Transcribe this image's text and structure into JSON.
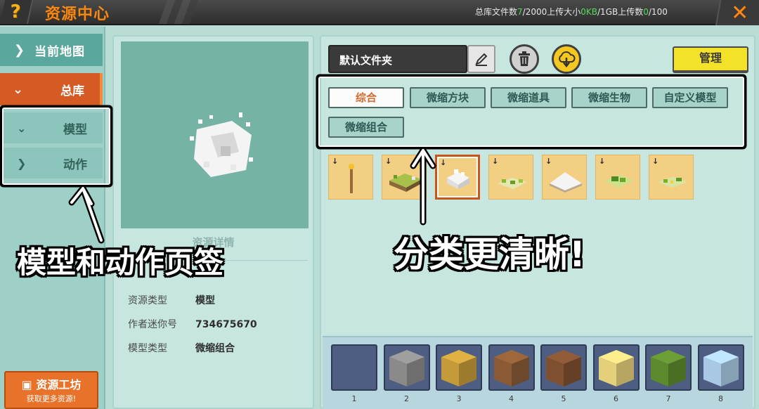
{
  "header": {
    "title": "资源中心",
    "help_icon": "?",
    "close_icon": "✕",
    "stats": {
      "files_label": "总库文件数",
      "files_used": "7",
      "files_total": "/2000",
      "size_label": "上传大小",
      "size_used": "0KB",
      "size_total": "/1GB",
      "uploads_label": "上传数",
      "uploads_used": "0",
      "uploads_total": "/100"
    }
  },
  "sidebar": {
    "current_map": "当前地图",
    "library": "总库",
    "model": "模型",
    "action": "动作",
    "workshop_title": "资源工坊",
    "workshop_sub": "获取更多资源!"
  },
  "detail": {
    "heading": "资源详情",
    "rows": [
      {
        "key": "资源类型",
        "value": "模型"
      },
      {
        "key": "作者迷你号",
        "value": "734675670"
      },
      {
        "key": "模型类型",
        "value": "微缩组合"
      }
    ]
  },
  "main": {
    "folder_name": "默认文件夹",
    "manage_label": "管理",
    "tabs": [
      "综合",
      "微缩方块",
      "微缩道具",
      "微缩生物",
      "自定义模型",
      "微缩组合"
    ],
    "active_tab": 0,
    "download_icon": "↓",
    "items": [
      {
        "icon": "torch-icon"
      },
      {
        "icon": "grass-block-icon"
      },
      {
        "icon": "white-cubes-icon",
        "selected": true
      },
      {
        "icon": "green-patch-icon"
      },
      {
        "icon": "snow-mound-icon"
      },
      {
        "icon": "leaf-patch-icon"
      },
      {
        "icon": "flower-patch-icon"
      }
    ]
  },
  "hotbar": {
    "slots": [
      {
        "num": "1",
        "block": "empty",
        "color": "#4e5d82"
      },
      {
        "num": "2",
        "block": "stone",
        "color": "#8a8a8a"
      },
      {
        "num": "3",
        "block": "hay",
        "color": "#c49a3a"
      },
      {
        "num": "4",
        "block": "wood",
        "color": "#8a5a34"
      },
      {
        "num": "5",
        "block": "wood",
        "color": "#7e5030"
      },
      {
        "num": "6",
        "block": "sand",
        "color": "#e4cf7a"
      },
      {
        "num": "7",
        "block": "grass",
        "color": "#5e8a2e"
      },
      {
        "num": "8",
        "block": "ice",
        "color": "#a8c8e4"
      }
    ]
  },
  "annotations": {
    "left": "模型和动作页签",
    "right": "分类更清晰!"
  }
}
